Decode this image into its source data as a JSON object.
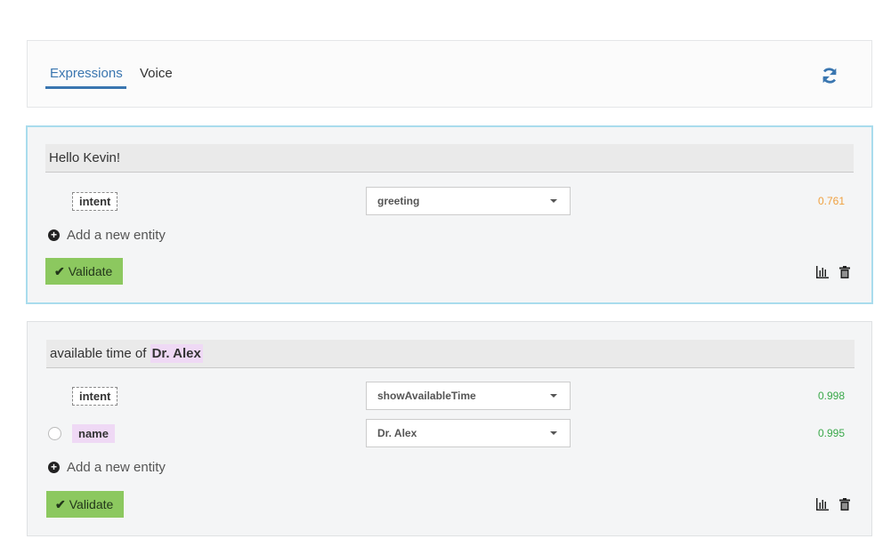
{
  "tabs": [
    {
      "label": "Expressions",
      "active": true
    },
    {
      "label": "Voice",
      "active": false
    }
  ],
  "colors": {
    "accent": "#3a76b0",
    "validate": "#8cc85f",
    "score_high": "#3aa84a",
    "score_mid": "#f0a040",
    "entity_highlight": "#efd9f5"
  },
  "expressions": [
    {
      "sentence": "Hello Kevin!",
      "entities": [
        {
          "tag": "intent",
          "value": "greeting",
          "score": "0.761"
        }
      ],
      "add_entity_label": "Add a new entity",
      "validate_label": "Validate",
      "actions": {
        "stats_icon": "bar-chart-icon",
        "delete_icon": "trash-icon"
      }
    },
    {
      "sentence_prefix": "available time of ",
      "sentence_highlight": "Dr. Alex",
      "entities": [
        {
          "tag": "intent",
          "value": "showAvailableTime",
          "score": "0.998"
        },
        {
          "tag": "name",
          "value": "Dr. Alex",
          "score": "0.995"
        }
      ],
      "add_entity_label": "Add a new entity",
      "validate_label": "Validate",
      "actions": {
        "stats_icon": "bar-chart-icon",
        "delete_icon": "trash-icon"
      }
    }
  ]
}
